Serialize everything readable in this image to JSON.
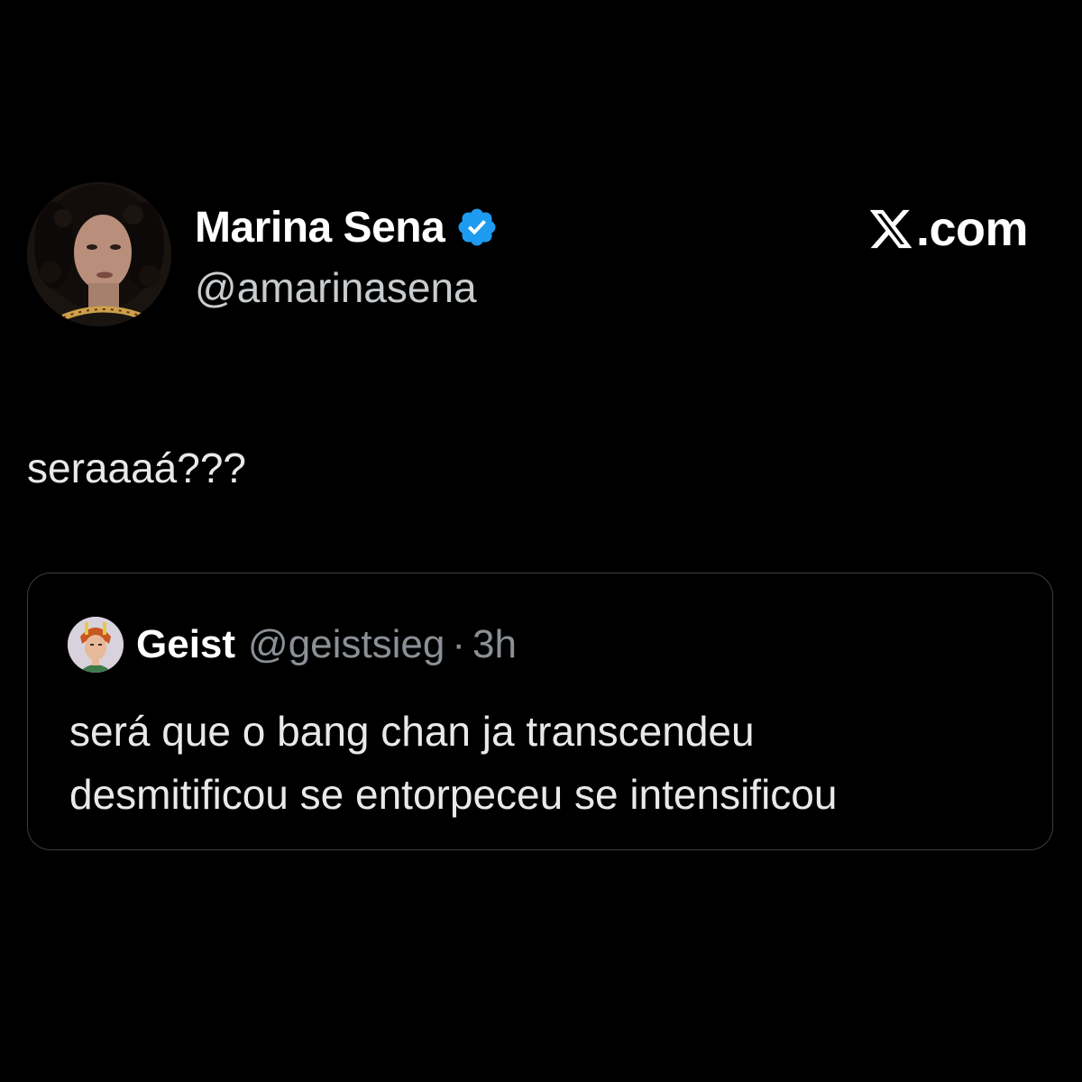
{
  "post": {
    "author": {
      "name": "Marina Sena",
      "handle": "@amarinasena",
      "verified": true,
      "avatar_icon": "profile-photo-avatar"
    },
    "brand": {
      "icon": "x-logo-icon",
      "text": ".com"
    },
    "text": "seraaaá???",
    "quoted": {
      "author_name": "Geist",
      "handle": "@geistsieg",
      "separator": "·",
      "time": "3h",
      "avatar_icon": "anime-character-avatar",
      "lines": [
        "será que o bang chan ja transcendeu",
        "desmitificou se entorpeceu se intensificou"
      ]
    }
  },
  "colors": {
    "background": "#000000",
    "primary_text": "#e7e9ea",
    "secondary_text": "#8b9096",
    "verified_badge": "#1d9bf0",
    "card_border": "#3a3d42"
  }
}
